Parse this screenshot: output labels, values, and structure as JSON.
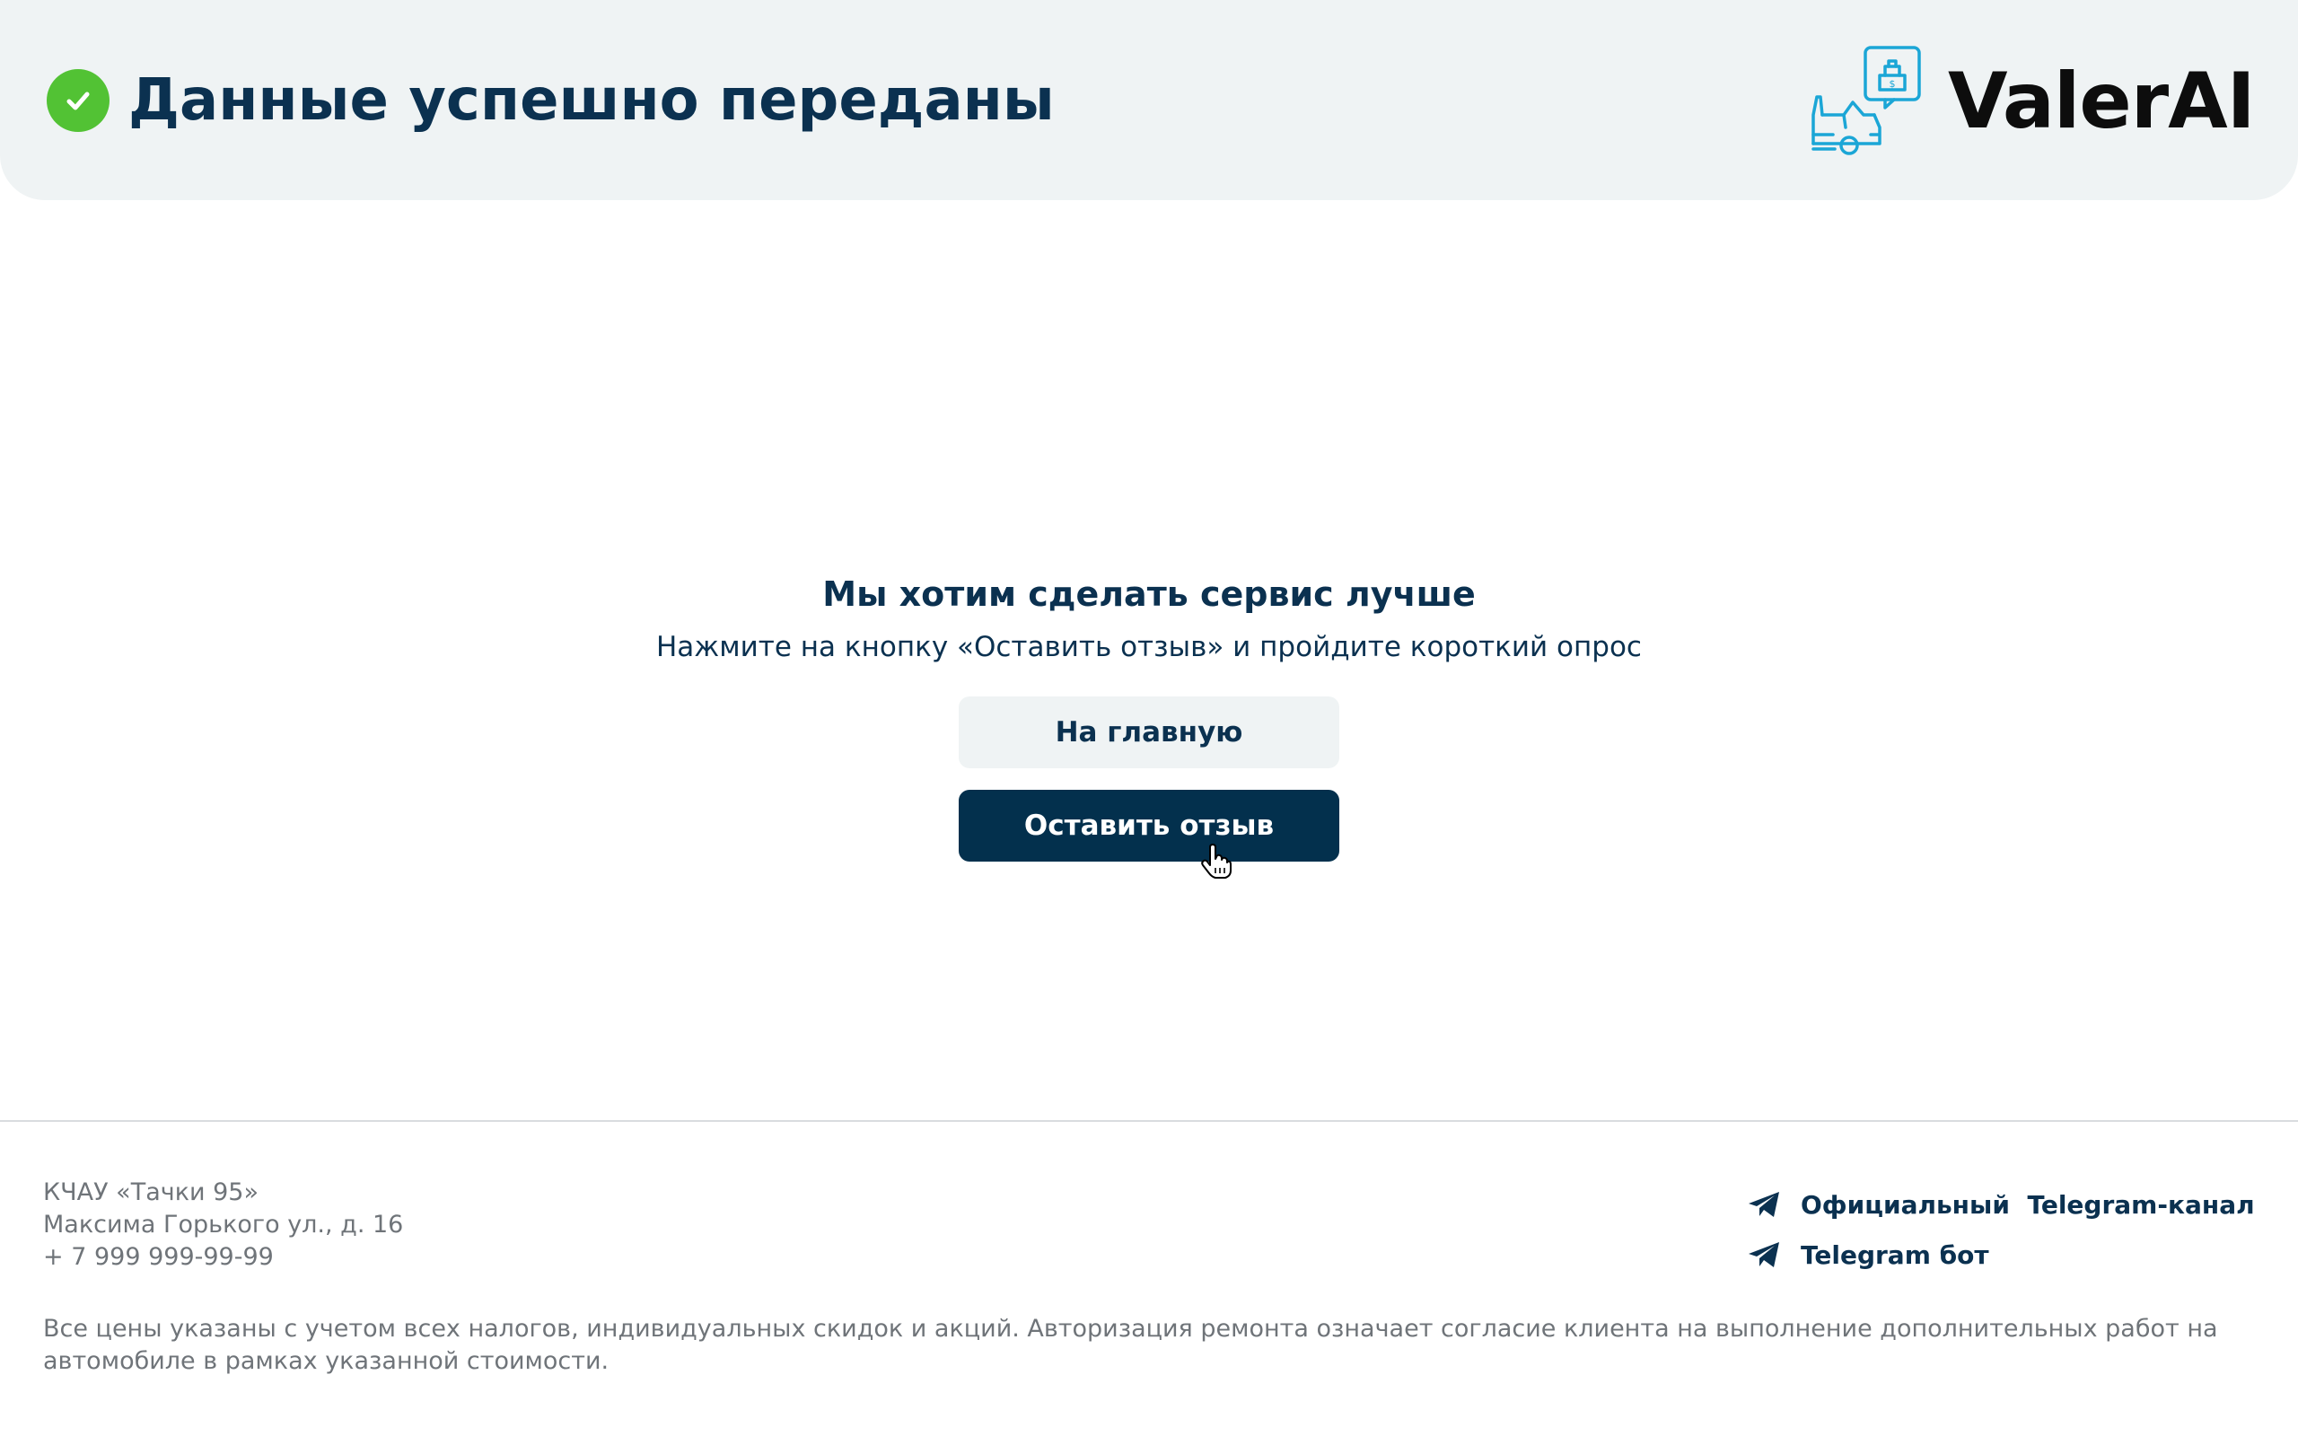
{
  "header": {
    "title": "Данные успешно переданы",
    "status_icon": "check-circle-icon",
    "logo_text": "ValerAI",
    "logo_icon": "car-repair-price-icon"
  },
  "main": {
    "title": "Мы хотим сделать сервис лучше",
    "subtitle": "Нажмите на кнопку «Оставить отзыв» и пройдите короткий опрос",
    "home_button": "На главную",
    "review_button": "Оставить отзыв"
  },
  "footer": {
    "company": "КЧАУ «Тачки 95»",
    "address": "Максима Горького ул., д. 16",
    "phone": "+ 7 999 999-99-99",
    "links": [
      {
        "label": "Официальный  Telegram-канал",
        "icon": "telegram-icon"
      },
      {
        "label": "Telegram бот",
        "icon": "telegram-icon"
      }
    ],
    "disclaimer": "Все цены указаны с учетом всех налогов, индивидуальных скидок и акций. Авторизация ремонта означает согласие клиента на выполнение дополнительных работ на автомобиле в рамках указанной стоимости."
  },
  "colors": {
    "primary": "#03304d",
    "success": "#52c234",
    "header_bg": "#eff3f4",
    "logo_accent": "#1ba6d6",
    "muted_text": "#6f7479"
  }
}
